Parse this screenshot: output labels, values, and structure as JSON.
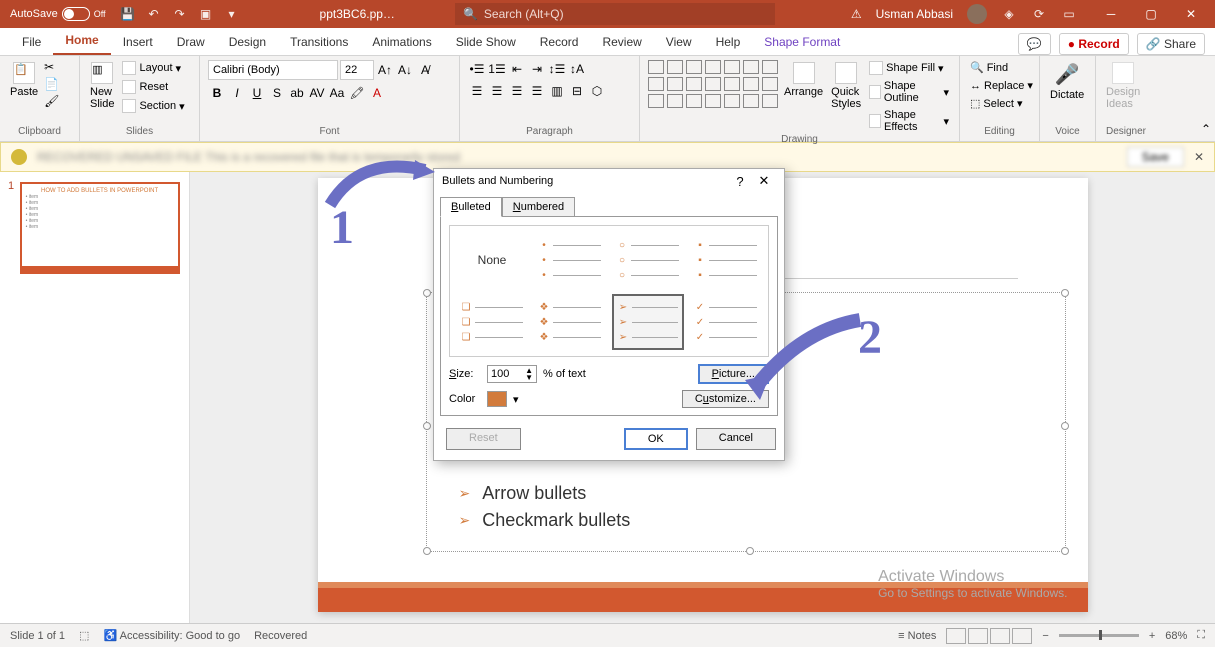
{
  "titlebar": {
    "autosave_label": "AutoSave",
    "autosave_state": "Off",
    "filename": "ppt3BC6.pp…",
    "search_placeholder": "Search (Alt+Q)",
    "username": "Usman Abbasi"
  },
  "ribbon": {
    "tabs": [
      "File",
      "Home",
      "Insert",
      "Draw",
      "Design",
      "Transitions",
      "Animations",
      "Slide Show",
      "Record",
      "Review",
      "View",
      "Help",
      "Shape Format"
    ],
    "active_tab": "Home",
    "record_btn": "Record",
    "share_btn": "Share",
    "groups": {
      "clipboard": {
        "label": "Clipboard",
        "paste": "Paste"
      },
      "slides": {
        "label": "Slides",
        "new_slide": "New\nSlide",
        "layout": "Layout",
        "reset": "Reset",
        "section": "Section"
      },
      "font": {
        "label": "Font",
        "family": "Calibri (Body)",
        "size": "22"
      },
      "paragraph": {
        "label": "Paragraph"
      },
      "drawing": {
        "label": "Drawing",
        "arrange": "Arrange",
        "quick": "Quick\nStyles",
        "fill": "Shape Fill",
        "outline": "Shape Outline",
        "effects": "Shape Effects"
      },
      "editing": {
        "label": "Editing",
        "find": "Find",
        "replace": "Replace",
        "select": "Select"
      },
      "voice": {
        "label": "Voice",
        "dictate": "Dictate"
      },
      "designer": {
        "label": "Designer",
        "ideas": "Design\nIdeas"
      }
    }
  },
  "slide": {
    "number": "1",
    "title_visible": "RPOINT",
    "bullets_visible": [
      "Arrow bullets",
      "Checkmark bullets"
    ]
  },
  "dialog": {
    "title": "Bullets and Numbering",
    "tab_bulleted": "Bulleted",
    "tab_numbered": "Numbered",
    "none": "None",
    "size_label": "Size:",
    "size_value": "100",
    "size_suffix": "% of text",
    "color_label": "Color",
    "picture_btn": "Picture...",
    "customize_btn": "Customize...",
    "reset_btn": "Reset",
    "ok_btn": "OK",
    "cancel_btn": "Cancel"
  },
  "annotations": {
    "n1": "1",
    "n2": "2"
  },
  "watermark": {
    "title": "Activate Windows",
    "sub": "Go to Settings to activate Windows."
  },
  "status": {
    "slide": "Slide 1 of 1",
    "accessibility": "Accessibility: Good to go",
    "recovered": "Recovered",
    "notes": "Notes",
    "zoom": "68%"
  }
}
